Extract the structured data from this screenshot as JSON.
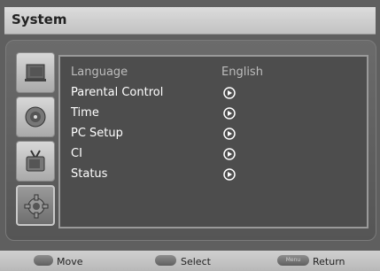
{
  "header": {
    "title": "System"
  },
  "sidebar": {
    "tabs": [
      {
        "icon": "picture-icon"
      },
      {
        "icon": "sound-icon"
      },
      {
        "icon": "channel-antenna-icon"
      },
      {
        "icon": "system-gear-icon",
        "active": true
      }
    ]
  },
  "menu": {
    "items": [
      {
        "label": "Language",
        "value": "English",
        "enabled": false
      },
      {
        "label": "Parental Control",
        "icon": "arrow-right-icon"
      },
      {
        "label": "Time",
        "icon": "arrow-right-icon"
      },
      {
        "label": "PC Setup",
        "icon": "arrow-right-icon"
      },
      {
        "label": "CI",
        "icon": "arrow-right-icon"
      },
      {
        "label": "Status",
        "icon": "arrow-right-icon"
      }
    ]
  },
  "footer": {
    "hints": [
      {
        "label": "Move"
      },
      {
        "label": "Select"
      },
      {
        "label": "Return",
        "key_label": "Menu"
      }
    ]
  }
}
